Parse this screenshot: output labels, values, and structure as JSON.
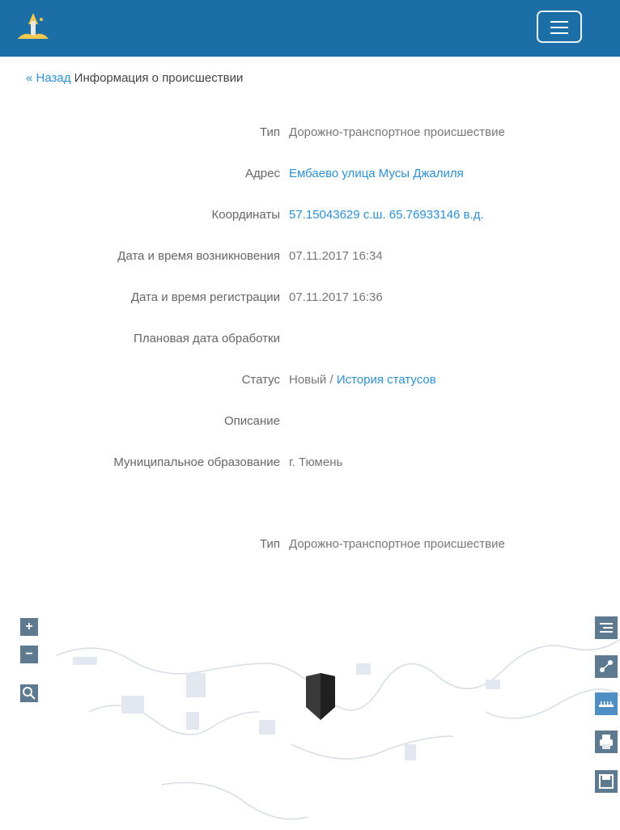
{
  "header": {
    "logo_icon": "city-emblem-icon",
    "menu_icon": "hamburger-menu-icon"
  },
  "breadcrumb": {
    "back_label": "« Назад",
    "title": "Информация о происшествии"
  },
  "incident": [
    {
      "label": "Тип",
      "value": "Дорожно-транспортное происшествие",
      "link": false
    },
    {
      "label": "Адрес",
      "value": "Ембаево улица Мусы Джалиля",
      "link": true
    },
    {
      "label": "Координаты",
      "value": "57.15043629 с.ш. 65.76933146 в.д.",
      "link": true
    },
    {
      "label": "Дата и время возникновения",
      "value": "07.11.2017 16:34",
      "link": false
    },
    {
      "label": "Дата и время регистрации",
      "value": "07.11.2017 16:36",
      "link": false
    },
    {
      "label": "Плановая дата обработки",
      "value": "",
      "link": false
    },
    {
      "label": "Статус",
      "value": "Новый",
      "link": false,
      "history_link": "История статусов"
    },
    {
      "label": "Описание",
      "value": "",
      "link": false
    },
    {
      "label": "Муниципальное образование",
      "value": "г. Тюмень",
      "link": false
    }
  ],
  "second_section": {
    "label": "Тип",
    "value": "Дорожно-транспортное происшествие"
  },
  "map": {
    "zoom_in": "+",
    "zoom_out": "−",
    "search_icon": "magnifier-icon",
    "tools": [
      "layers-icon",
      "measure-icon",
      "ruler-icon",
      "print-icon",
      "save-icon"
    ],
    "colors": {
      "button": "#5d7a91",
      "navbar": "#1b6fa6",
      "link": "#2f8fd1"
    }
  }
}
